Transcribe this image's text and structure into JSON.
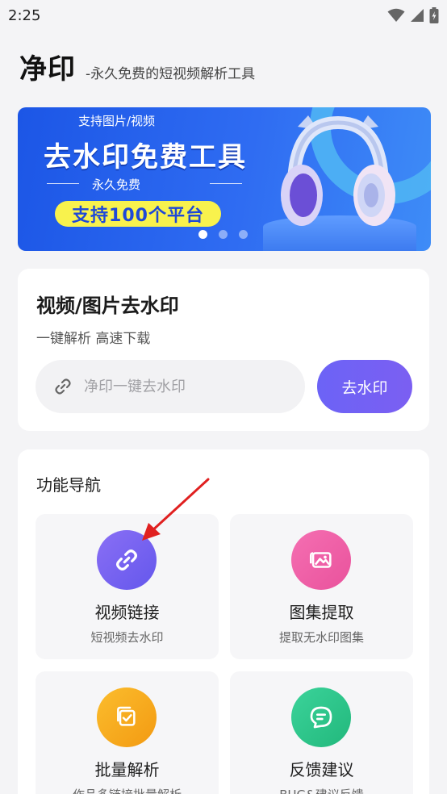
{
  "status_bar": {
    "time": "2:25",
    "icons": [
      "wifi-icon",
      "signal-icon",
      "battery-charging-icon"
    ]
  },
  "header": {
    "title": "净印",
    "subtitle": "-永久免费的短视频解析工具"
  },
  "banner": {
    "tag": "支持图片/视频",
    "headline": "去水印免费工具",
    "free_text": "永久免费",
    "pill_text": "支持100个平台",
    "dots_total": 3,
    "active_dot": 1,
    "colors": {
      "background": "#2f6cf2",
      "pill": "#f8f24d"
    }
  },
  "watermark_card": {
    "title": "视频/图片去水印",
    "subtitle": "一键解析 高速下载",
    "input_placeholder": "净印一键去水印",
    "input_value": "",
    "button_label": "去水印",
    "button_color": "#6e62f5"
  },
  "nav": {
    "heading": "功能导航",
    "tiles": [
      {
        "title": "视频链接",
        "desc": "短视频去水印",
        "icon": "link-icon",
        "color": "#7665f1"
      },
      {
        "title": "图集提取",
        "desc": "提取无水印图集",
        "icon": "gallery-icon",
        "color": "#ee5da6"
      },
      {
        "title": "批量解析",
        "desc": "作品多链接批量解析",
        "icon": "batch-check-icon",
        "color": "#f6aa1c"
      },
      {
        "title": "反馈建议",
        "desc": "BUG&建议反馈",
        "icon": "feedback-icon",
        "color": "#2fc68c"
      }
    ]
  },
  "annotation": {
    "arrow_color": "#e02020"
  }
}
